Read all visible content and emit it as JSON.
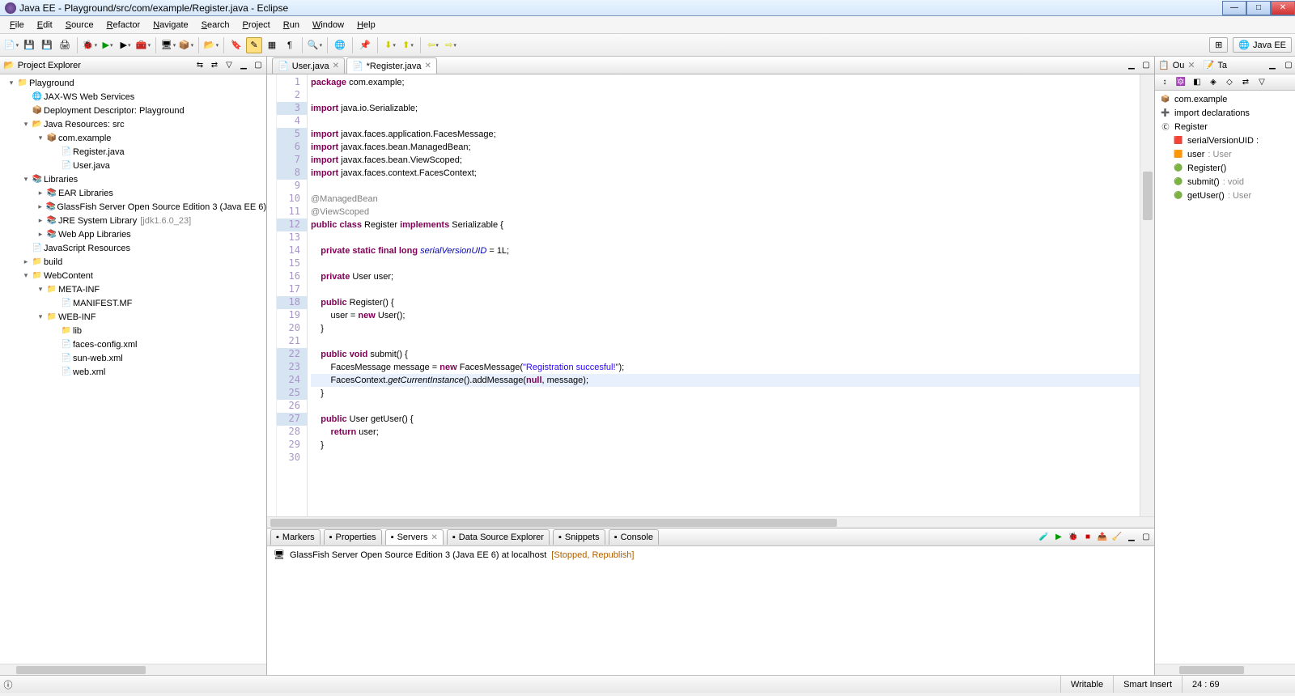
{
  "window": {
    "title": "Java EE - Playground/src/com/example/Register.java - Eclipse"
  },
  "menu": [
    "File",
    "Edit",
    "Source",
    "Refactor",
    "Navigate",
    "Search",
    "Project",
    "Run",
    "Window",
    "Help"
  ],
  "perspective": {
    "open_icon": "⊞",
    "label": "Java EE"
  },
  "project_explorer": {
    "title": "Project Explorer",
    "nodes": [
      {
        "depth": 0,
        "exp": "▾",
        "icon": "📁",
        "label": "Playground"
      },
      {
        "depth": 1,
        "exp": " ",
        "icon": "🌐",
        "label": "JAX-WS Web Services"
      },
      {
        "depth": 1,
        "exp": " ",
        "icon": "📦",
        "label": "Deployment Descriptor: Playground"
      },
      {
        "depth": 1,
        "exp": "▾",
        "icon": "📂",
        "label": "Java Resources: src"
      },
      {
        "depth": 2,
        "exp": "▾",
        "icon": "📦",
        "label": "com.example"
      },
      {
        "depth": 3,
        "exp": " ",
        "icon": "📄",
        "label": "Register.java"
      },
      {
        "depth": 3,
        "exp": " ",
        "icon": "📄",
        "label": "User.java"
      },
      {
        "depth": 1,
        "exp": "▾",
        "icon": "📚",
        "label": "Libraries"
      },
      {
        "depth": 2,
        "exp": "▸",
        "icon": "📚",
        "label": "EAR Libraries"
      },
      {
        "depth": 2,
        "exp": "▸",
        "icon": "📚",
        "label": "GlassFish Server Open Source Edition 3 (Java EE 6)"
      },
      {
        "depth": 2,
        "exp": "▸",
        "icon": "📚",
        "label": "JRE System Library",
        "desc": "[jdk1.6.0_23]"
      },
      {
        "depth": 2,
        "exp": "▸",
        "icon": "📚",
        "label": "Web App Libraries"
      },
      {
        "depth": 1,
        "exp": " ",
        "icon": "📄",
        "label": "JavaScript Resources"
      },
      {
        "depth": 1,
        "exp": "▸",
        "icon": "📁",
        "label": "build"
      },
      {
        "depth": 1,
        "exp": "▾",
        "icon": "📁",
        "label": "WebContent"
      },
      {
        "depth": 2,
        "exp": "▾",
        "icon": "📁",
        "label": "META-INF"
      },
      {
        "depth": 3,
        "exp": " ",
        "icon": "📄",
        "label": "MANIFEST.MF"
      },
      {
        "depth": 2,
        "exp": "▾",
        "icon": "📁",
        "label": "WEB-INF"
      },
      {
        "depth": 3,
        "exp": " ",
        "icon": "📁",
        "label": "lib"
      },
      {
        "depth": 3,
        "exp": " ",
        "icon": "📄",
        "label": "faces-config.xml"
      },
      {
        "depth": 3,
        "exp": " ",
        "icon": "📄",
        "label": "sun-web.xml"
      },
      {
        "depth": 3,
        "exp": " ",
        "icon": "📄",
        "label": "web.xml"
      }
    ]
  },
  "editor": {
    "tabs": [
      {
        "label": "User.java",
        "dirty": false
      },
      {
        "label": "*Register.java",
        "dirty": true
      }
    ],
    "active_tab": 1,
    "lines": [
      {
        "n": 1,
        "html": "<span class='kw'>package</span> com.example;"
      },
      {
        "n": 2,
        "html": ""
      },
      {
        "n": 3,
        "mark": true,
        "html": "<span class='kw'>import</span> java.io.Serializable;"
      },
      {
        "n": 4,
        "html": ""
      },
      {
        "n": 5,
        "mark": true,
        "html": "<span class='kw'>import</span> javax.faces.application.FacesMessage;"
      },
      {
        "n": 6,
        "mark": true,
        "html": "<span class='kw'>import</span> javax.faces.bean.ManagedBean;"
      },
      {
        "n": 7,
        "mark": true,
        "html": "<span class='kw'>import</span> javax.faces.bean.ViewScoped;"
      },
      {
        "n": 8,
        "mark": true,
        "html": "<span class='kw'>import</span> javax.faces.context.FacesContext;"
      },
      {
        "n": 9,
        "html": ""
      },
      {
        "n": 10,
        "html": "<span class='ann'>@ManagedBean</span>"
      },
      {
        "n": 11,
        "html": "<span class='ann'>@ViewScoped</span>"
      },
      {
        "n": 12,
        "mark": true,
        "html": "<span class='kw'>public</span> <span class='kw'>class</span> Register <span class='kw'>implements</span> Serializable {"
      },
      {
        "n": 13,
        "html": ""
      },
      {
        "n": 14,
        "html": "    <span class='kw'>private</span> <span class='kw'>static</span> <span class='kw'>final</span> <span class='kw'>long</span> <span class='it'>serialVersionUID</span> = 1L;"
      },
      {
        "n": 15,
        "html": ""
      },
      {
        "n": 16,
        "html": "    <span class='kw'>private</span> User user;"
      },
      {
        "n": 17,
        "html": ""
      },
      {
        "n": 18,
        "mark": true,
        "html": "    <span class='kw'>public</span> Register() {"
      },
      {
        "n": 19,
        "html": "        user = <span class='kw'>new</span> User();"
      },
      {
        "n": 20,
        "html": "    }"
      },
      {
        "n": 21,
        "html": ""
      },
      {
        "n": 22,
        "mark": true,
        "html": "    <span class='kw'>public</span> <span class='kw'>void</span> submit() {"
      },
      {
        "n": 23,
        "mark": true,
        "html": "        FacesMessage message = <span class='kw'>new</span> FacesMessage(<span class='str'>\"Registration succesful!\"</span>);"
      },
      {
        "n": 24,
        "mark": true,
        "cursor": true,
        "html": "        FacesContext.<span style='font-style:italic'>getCurrentInstance</span>().addMessage(<span class='kw'>null</span>, message);"
      },
      {
        "n": 25,
        "mark": true,
        "html": "    }"
      },
      {
        "n": 26,
        "html": ""
      },
      {
        "n": 27,
        "mark": true,
        "html": "    <span class='kw'>public</span> User getUser() {"
      },
      {
        "n": 28,
        "html": "        <span class='kw'>return</span> user;"
      },
      {
        "n": 29,
        "html": "    }"
      },
      {
        "n": 30,
        "html": ""
      }
    ]
  },
  "outline": {
    "tab1": "Ou",
    "tab2": "Ta",
    "nodes": [
      {
        "depth": 0,
        "icon": "📦",
        "label": "com.example"
      },
      {
        "depth": 0,
        "icon": "➕",
        "label": "import declarations"
      },
      {
        "depth": 0,
        "icon": "Ⓒ",
        "label": "Register"
      },
      {
        "depth": 1,
        "icon": "🟥",
        "label": "serialVersionUID :"
      },
      {
        "depth": 1,
        "icon": "🟧",
        "label": "user",
        "type": "User"
      },
      {
        "depth": 1,
        "icon": "🟢",
        "label": "Register()"
      },
      {
        "depth": 1,
        "icon": "🟢",
        "label": "submit()",
        "type": "void"
      },
      {
        "depth": 1,
        "icon": "🟢",
        "label": "getUser()",
        "type": "User"
      }
    ]
  },
  "bottom": {
    "tabs": [
      "Markers",
      "Properties",
      "Servers",
      "Data Source Explorer",
      "Snippets",
      "Console"
    ],
    "active": 2,
    "server": {
      "name": "GlassFish Server Open Source Edition 3 (Java EE 6) at localhost",
      "status": "[Stopped, Republish]"
    }
  },
  "status": {
    "writable": "Writable",
    "insert": "Smart Insert",
    "pos": "24 : 69"
  }
}
